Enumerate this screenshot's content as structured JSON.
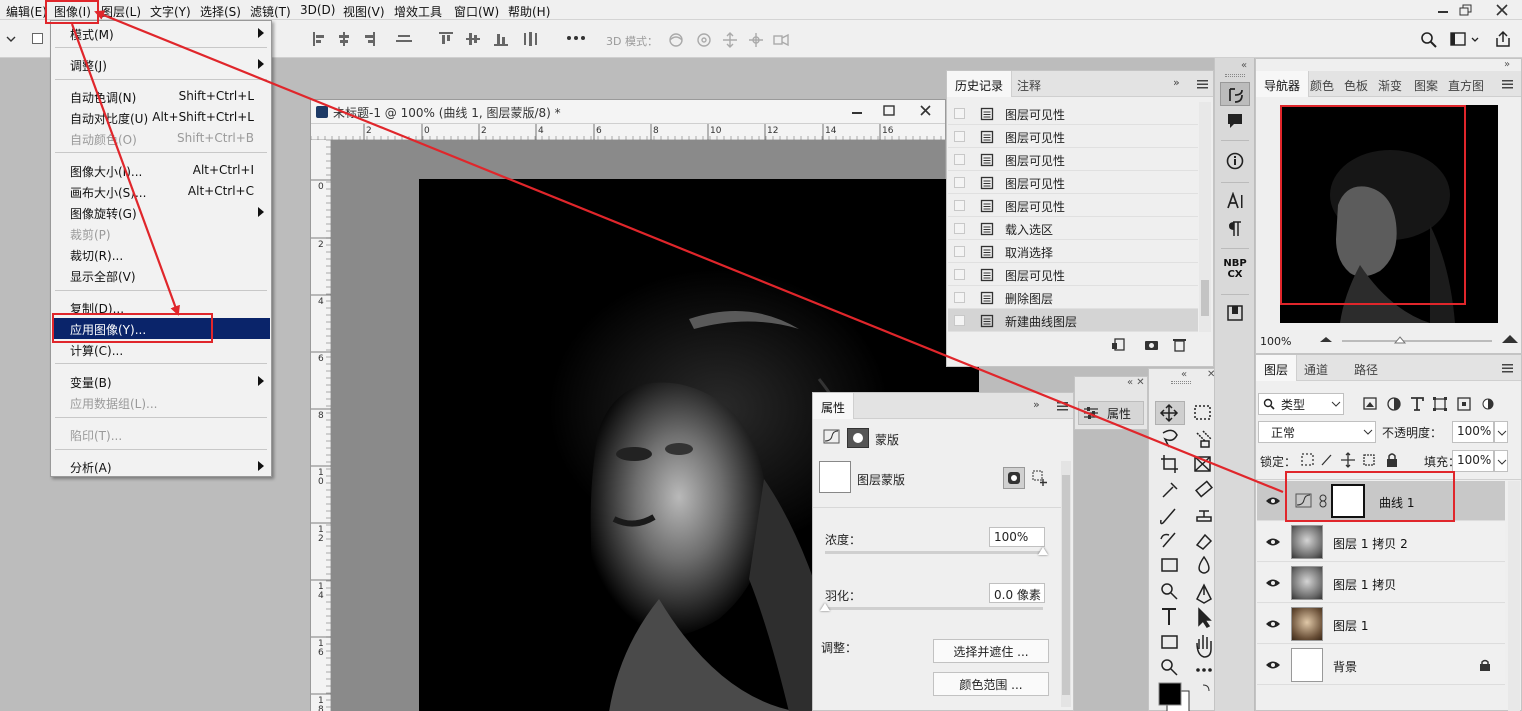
{
  "menubar": {
    "items": [
      "编辑(E)",
      "图像(I)",
      "图层(L)",
      "文字(Y)",
      "选择(S)",
      "滤镜(T)",
      "3D(D)",
      "视图(V)",
      "增效工具",
      "窗口(W)",
      "帮助(H)"
    ]
  },
  "options_bar": {
    "mode_3d_label": "3D 模式："
  },
  "document": {
    "title": "未标题-1 @ 100% (曲线 1, 图层蒙版/8) *",
    "ruler_h": [
      "2",
      "0",
      "2",
      "4",
      "6",
      "8",
      "10",
      "12",
      "14",
      "16"
    ],
    "ruler_v": [
      "0",
      "2",
      "4",
      "6",
      "8",
      "1\n0",
      "1\n2",
      "1\n4",
      "1\n6",
      "1\n8"
    ]
  },
  "image_menu": {
    "items": [
      {
        "label": "模式(M)",
        "shortcut": "",
        "submenu": true,
        "disabled": false
      },
      {
        "label": "调整(J)",
        "shortcut": "",
        "submenu": true,
        "disabled": false
      },
      {
        "label": "自动色调(N)",
        "shortcut": "Shift+Ctrl+L",
        "submenu": false,
        "disabled": false
      },
      {
        "label": "自动对比度(U)",
        "shortcut": "Alt+Shift+Ctrl+L",
        "submenu": false,
        "disabled": false
      },
      {
        "label": "自动颜色(O)",
        "shortcut": "Shift+Ctrl+B",
        "submenu": false,
        "disabled": true
      },
      {
        "label": "图像大小(I)...",
        "shortcut": "Alt+Ctrl+I",
        "submenu": false,
        "disabled": false
      },
      {
        "label": "画布大小(S)...",
        "shortcut": "Alt+Ctrl+C",
        "submenu": false,
        "disabled": false
      },
      {
        "label": "图像旋转(G)",
        "shortcut": "",
        "submenu": true,
        "disabled": false
      },
      {
        "label": "裁剪(P)",
        "shortcut": "",
        "submenu": false,
        "disabled": true
      },
      {
        "label": "裁切(R)...",
        "shortcut": "",
        "submenu": false,
        "disabled": false
      },
      {
        "label": "显示全部(V)",
        "shortcut": "",
        "submenu": false,
        "disabled": false
      },
      {
        "label": "复制(D)...",
        "shortcut": "",
        "submenu": false,
        "disabled": false
      },
      {
        "label": "应用图像(Y)...",
        "shortcut": "",
        "submenu": false,
        "disabled": false,
        "highlighted": true
      },
      {
        "label": "计算(C)...",
        "shortcut": "",
        "submenu": false,
        "disabled": false
      },
      {
        "label": "变量(B)",
        "shortcut": "",
        "submenu": true,
        "disabled": false
      },
      {
        "label": "应用数据组(L)...",
        "shortcut": "",
        "submenu": false,
        "disabled": true
      },
      {
        "label": "陷印(T)...",
        "shortcut": "",
        "submenu": false,
        "disabled": true
      },
      {
        "label": "分析(A)",
        "shortcut": "",
        "submenu": true,
        "disabled": false
      }
    ]
  },
  "history": {
    "tabs": [
      "历史记录",
      "注释"
    ],
    "items": [
      "图层可见性",
      "图层可见性",
      "图层可见性",
      "图层可见性",
      "图层可见性",
      "载入选区",
      "取消选择",
      "图层可见性",
      "删除图层",
      "新建曲线图层"
    ]
  },
  "properties": {
    "tab": "属性",
    "section": "蒙版",
    "mask_label": "图层蒙版",
    "density_label": "浓度：",
    "density_value": "100%",
    "density_level": 1.0,
    "feather_label": "羽化：",
    "feather_value": "0.0 像素",
    "feather_level": 0.0,
    "adjust_label": "调整：",
    "select_mask_button": "选择并遮住 ...",
    "color_range_button": "颜色范围 ..."
  },
  "collapsed_properties": {
    "label": "属性"
  },
  "navigator": {
    "tabs": [
      "导航器",
      "颜色",
      "色板",
      "渐变",
      "图案",
      "直方图"
    ],
    "zoom": "100%"
  },
  "layers": {
    "tabs": [
      "图层",
      "通道",
      "路径"
    ],
    "filter_kind": "类型",
    "blend_mode": "正常",
    "opacity_label": "不透明度：",
    "opacity": "100%",
    "lock_label": "锁定：",
    "fill_label": "填充：",
    "fill": "100%",
    "items": [
      {
        "name": "曲线 1",
        "type": "curves",
        "selected": true
      },
      {
        "name": "图层 1 拷贝 2",
        "type": "photo-gray"
      },
      {
        "name": "图层 1 拷贝",
        "type": "photo-gray"
      },
      {
        "name": "图层 1",
        "type": "photo-sepia"
      },
      {
        "name": "背景",
        "type": "white",
        "locked": true
      }
    ]
  },
  "colors": {
    "annotation": "#e0262b",
    "highlight": "#0a246a"
  }
}
